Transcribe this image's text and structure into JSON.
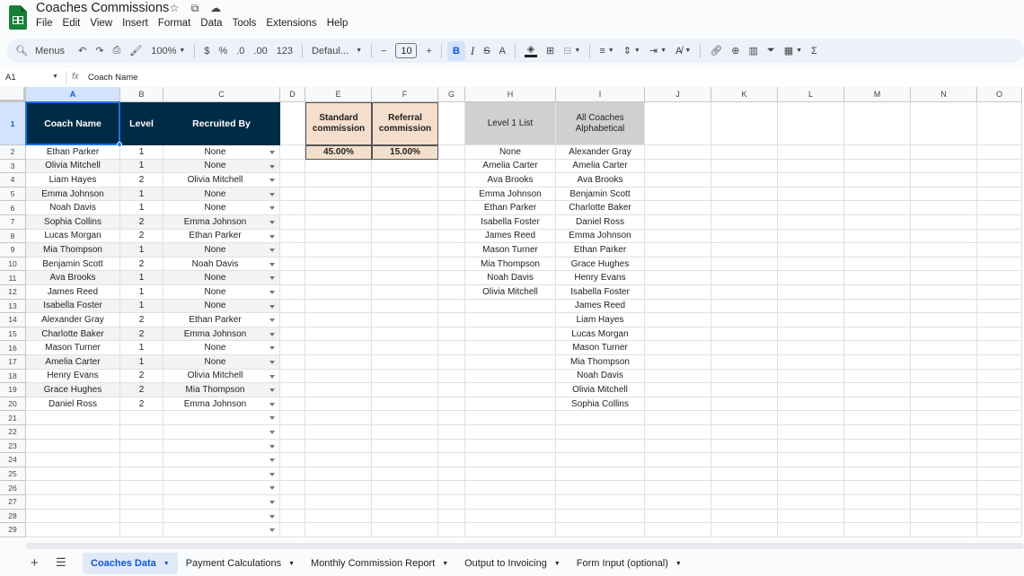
{
  "app": {
    "title": "Coaches Commissions",
    "menu": [
      "File",
      "Edit",
      "View",
      "Insert",
      "Format",
      "Data",
      "Tools",
      "Extensions",
      "Help"
    ]
  },
  "toolbar": {
    "menus_label": "Menus",
    "zoom": "100%",
    "currency": "$",
    "percent": "%",
    "dec_decrease": ".0",
    "dec_increase": ".00",
    "number_format": "123",
    "font": "Defaul...",
    "font_size": "10",
    "minus": "−",
    "plus": "+",
    "bold": "B",
    "italic": "I",
    "strike": "S",
    "text_color_letter": "A",
    "sum": "Σ"
  },
  "formula_bar": {
    "cell_ref": "A1",
    "fx": "fx",
    "content": "Coach Name"
  },
  "columns": [
    "A",
    "B",
    "C",
    "D",
    "E",
    "F",
    "G",
    "H",
    "I",
    "J",
    "K",
    "L",
    "M",
    "N",
    "O"
  ],
  "header": {
    "coach_name": "Coach Name",
    "level": "Level",
    "recruited_by": "Recruited By",
    "standard_commission": "Standard commission",
    "referral_commission": "Referral commission",
    "level1_list": "Level 1 List",
    "all_coaches": "All Coaches Alphabetical"
  },
  "rates": {
    "standard": "45.00%",
    "referral": "15.00%"
  },
  "coaches": [
    {
      "name": "Ethan Parker",
      "level": "1",
      "recruited_by": "None"
    },
    {
      "name": "Olivia Mitchell",
      "level": "1",
      "recruited_by": "None"
    },
    {
      "name": "Liam Hayes",
      "level": "2",
      "recruited_by": "Olivia Mitchell"
    },
    {
      "name": "Emma Johnson",
      "level": "1",
      "recruited_by": "None"
    },
    {
      "name": "Noah Davis",
      "level": "1",
      "recruited_by": "None"
    },
    {
      "name": "Sophia Collins",
      "level": "2",
      "recruited_by": "Emma Johnson"
    },
    {
      "name": "Lucas Morgan",
      "level": "2",
      "recruited_by": "Ethan Parker"
    },
    {
      "name": "Mia Thompson",
      "level": "1",
      "recruited_by": "None"
    },
    {
      "name": "Benjamin Scott",
      "level": "2",
      "recruited_by": "Noah Davis"
    },
    {
      "name": "Ava Brooks",
      "level": "1",
      "recruited_by": "None"
    },
    {
      "name": "James Reed",
      "level": "1",
      "recruited_by": "None"
    },
    {
      "name": "Isabella Foster",
      "level": "1",
      "recruited_by": "None"
    },
    {
      "name": "Alexander Gray",
      "level": "2",
      "recruited_by": "Ethan Parker"
    },
    {
      "name": "Charlotte Baker",
      "level": "2",
      "recruited_by": "Emma Johnson"
    },
    {
      "name": "Mason Turner",
      "level": "1",
      "recruited_by": "None"
    },
    {
      "name": "Amelia Carter",
      "level": "1",
      "recruited_by": "None"
    },
    {
      "name": "Henry Evans",
      "level": "2",
      "recruited_by": "Olivia Mitchell"
    },
    {
      "name": "Grace Hughes",
      "level": "2",
      "recruited_by": "Mia Thompson"
    },
    {
      "name": "Daniel Ross",
      "level": "2",
      "recruited_by": "Emma Johnson"
    }
  ],
  "level1_list": [
    "None",
    "Amelia Carter",
    "Ava Brooks",
    "Emma Johnson",
    "Ethan Parker",
    "Isabella Foster",
    "James Reed",
    "Mason Turner",
    "Mia Thompson",
    "Noah Davis",
    "Olivia Mitchell"
  ],
  "all_coaches_alpha": [
    "Alexander Gray",
    "Amelia Carter",
    "Ava Brooks",
    "Benjamin Scott",
    "Charlotte Baker",
    "Daniel Ross",
    "Emma Johnson",
    "Ethan Parker",
    "Grace Hughes",
    "Henry Evans",
    "Isabella Foster",
    "James Reed",
    "Liam Hayes",
    "Lucas Morgan",
    "Mason Turner",
    "Mia Thompson",
    "Noah Davis",
    "Olivia Mitchell",
    "Sophia Collins"
  ],
  "row_numbers": [
    "1",
    "2",
    "3",
    "4",
    "5",
    "6",
    "7",
    "8",
    "9",
    "10",
    "11",
    "12",
    "13",
    "14",
    "15",
    "16",
    "17",
    "18",
    "19",
    "20",
    "21",
    "22",
    "23",
    "24",
    "25",
    "26",
    "27",
    "28",
    "29"
  ],
  "sheets": [
    {
      "label": "Coaches Data",
      "active": true
    },
    {
      "label": "Payment Calculations",
      "active": false
    },
    {
      "label": "Monthly Commission Report",
      "active": false
    },
    {
      "label": "Output to Invoicing",
      "active": false
    },
    {
      "label": "Form Input (optional)",
      "active": false
    }
  ],
  "colors": {
    "header_dark": "#002b45",
    "header_tan": "#f4dfcc",
    "header_gray": "#d0d0d0",
    "selection": "#1a73e8",
    "brand": "#188038"
  }
}
